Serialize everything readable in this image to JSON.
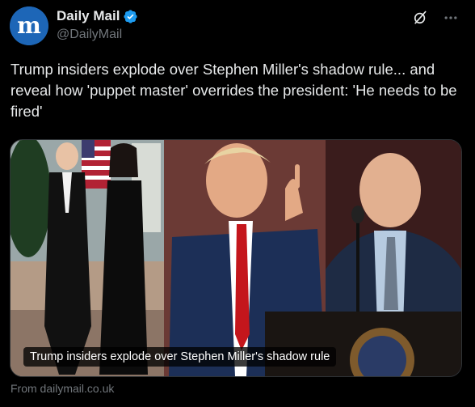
{
  "author": {
    "display_name": "Daily Mail",
    "handle": "@DailyMail",
    "avatar_letter": "m",
    "verified": true
  },
  "tweet": {
    "text": "Trump insiders explode over Stephen Miller's shadow rule... and reveal how 'puppet master' overrides the president: 'He needs to be fired'"
  },
  "card": {
    "caption": "Trump insiders explode over Stephen Miller's shadow rule",
    "source": "From dailymail.co.uk"
  },
  "icons": {
    "grok": "grok-icon",
    "more": "more-icon",
    "verified": "verified-badge-icon"
  },
  "colors": {
    "background": "#000000",
    "text": "#e7e9ea",
    "secondary_text": "#71767b",
    "verified_blue": "#1d9bf0",
    "avatar_blue": "#1d66b7"
  }
}
